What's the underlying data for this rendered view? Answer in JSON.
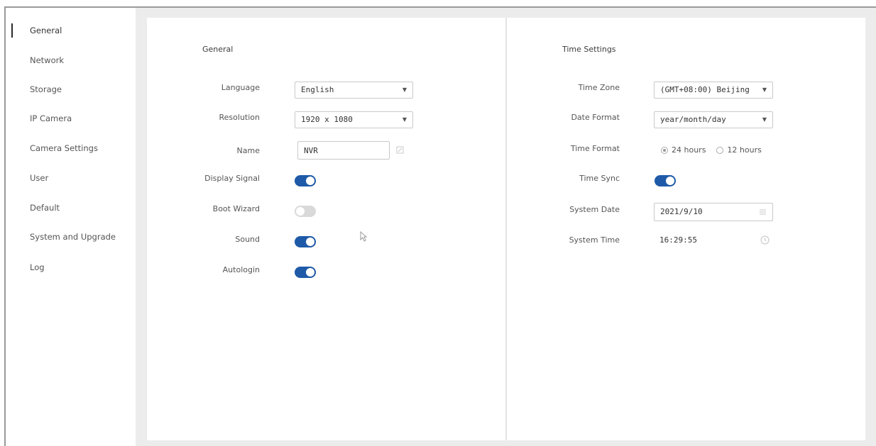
{
  "sidebar": {
    "items": [
      {
        "label": "General",
        "active": true
      },
      {
        "label": "Network"
      },
      {
        "label": "Storage"
      },
      {
        "label": "IP Camera"
      },
      {
        "label": "Camera Settings"
      },
      {
        "label": "User"
      },
      {
        "label": "Default"
      },
      {
        "label": "System and Upgrade"
      },
      {
        "label": "Log"
      }
    ]
  },
  "general": {
    "title": "General",
    "language": {
      "label": "Language",
      "value": "English"
    },
    "resolution": {
      "label": "Resolution",
      "value": "1920 x 1080"
    },
    "name": {
      "label": "Name",
      "value": "NVR"
    },
    "display_signal": {
      "label": "Display Signal",
      "on": true
    },
    "boot_wizard": {
      "label": "Boot Wizard",
      "on": false
    },
    "sound": {
      "label": "Sound",
      "on": true
    },
    "autologin": {
      "label": "Autologin",
      "on": true
    }
  },
  "time": {
    "title": "Time Settings",
    "time_zone": {
      "label": "Time Zone",
      "value": "(GMT+08:00) Beijing"
    },
    "date_format": {
      "label": "Date Format",
      "value": "year/month/day"
    },
    "time_format": {
      "label": "Time Format",
      "options": [
        "24 hours",
        "12 hours"
      ],
      "selected": "24 hours"
    },
    "time_sync": {
      "label": "Time Sync",
      "on": true
    },
    "system_date": {
      "label": "System Date",
      "value": "2021/9/10"
    },
    "system_time": {
      "label": "System Time",
      "value": "16:29:55"
    }
  },
  "icons": {
    "dropdown": "▼",
    "edit": "edit-icon",
    "calendar": "calendar-icon",
    "clock": "clock-icon"
  },
  "colors": {
    "accent": "#1e5aa8",
    "toggle_off": "#d9d9d9",
    "background": "#ececec"
  }
}
